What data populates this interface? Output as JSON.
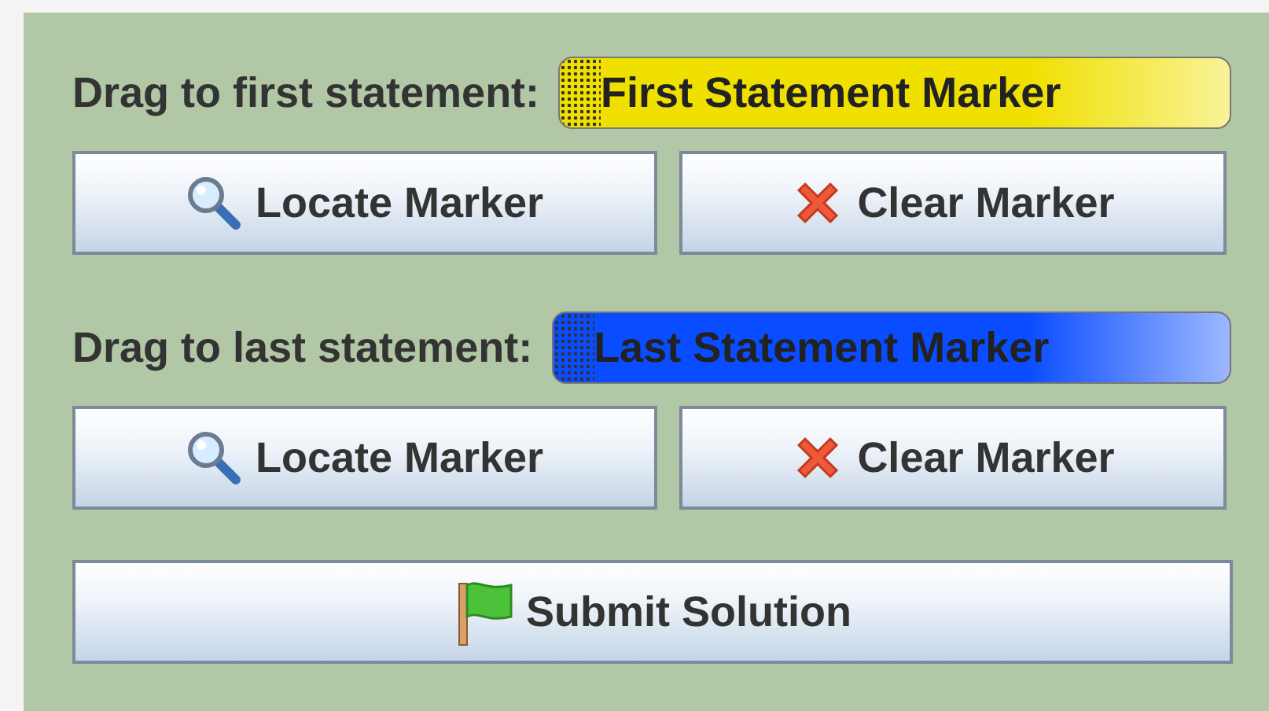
{
  "sections": [
    {
      "label": "Drag to first statement:",
      "marker": {
        "text": "First Statement Marker",
        "color": "#f0e000"
      },
      "buttons": [
        {
          "label": "Locate Marker",
          "kind": "locate"
        },
        {
          "label": "Clear Marker",
          "kind": "clear"
        }
      ]
    },
    {
      "label": "Drag to last statement:",
      "marker": {
        "text": "Last Statement Marker",
        "color": "#0a4cff"
      },
      "buttons": [
        {
          "label": "Locate Marker",
          "kind": "locate"
        },
        {
          "label": "Clear Marker",
          "kind": "clear"
        }
      ]
    }
  ],
  "submit": {
    "label": "Submit Solution",
    "kind": "flag"
  }
}
